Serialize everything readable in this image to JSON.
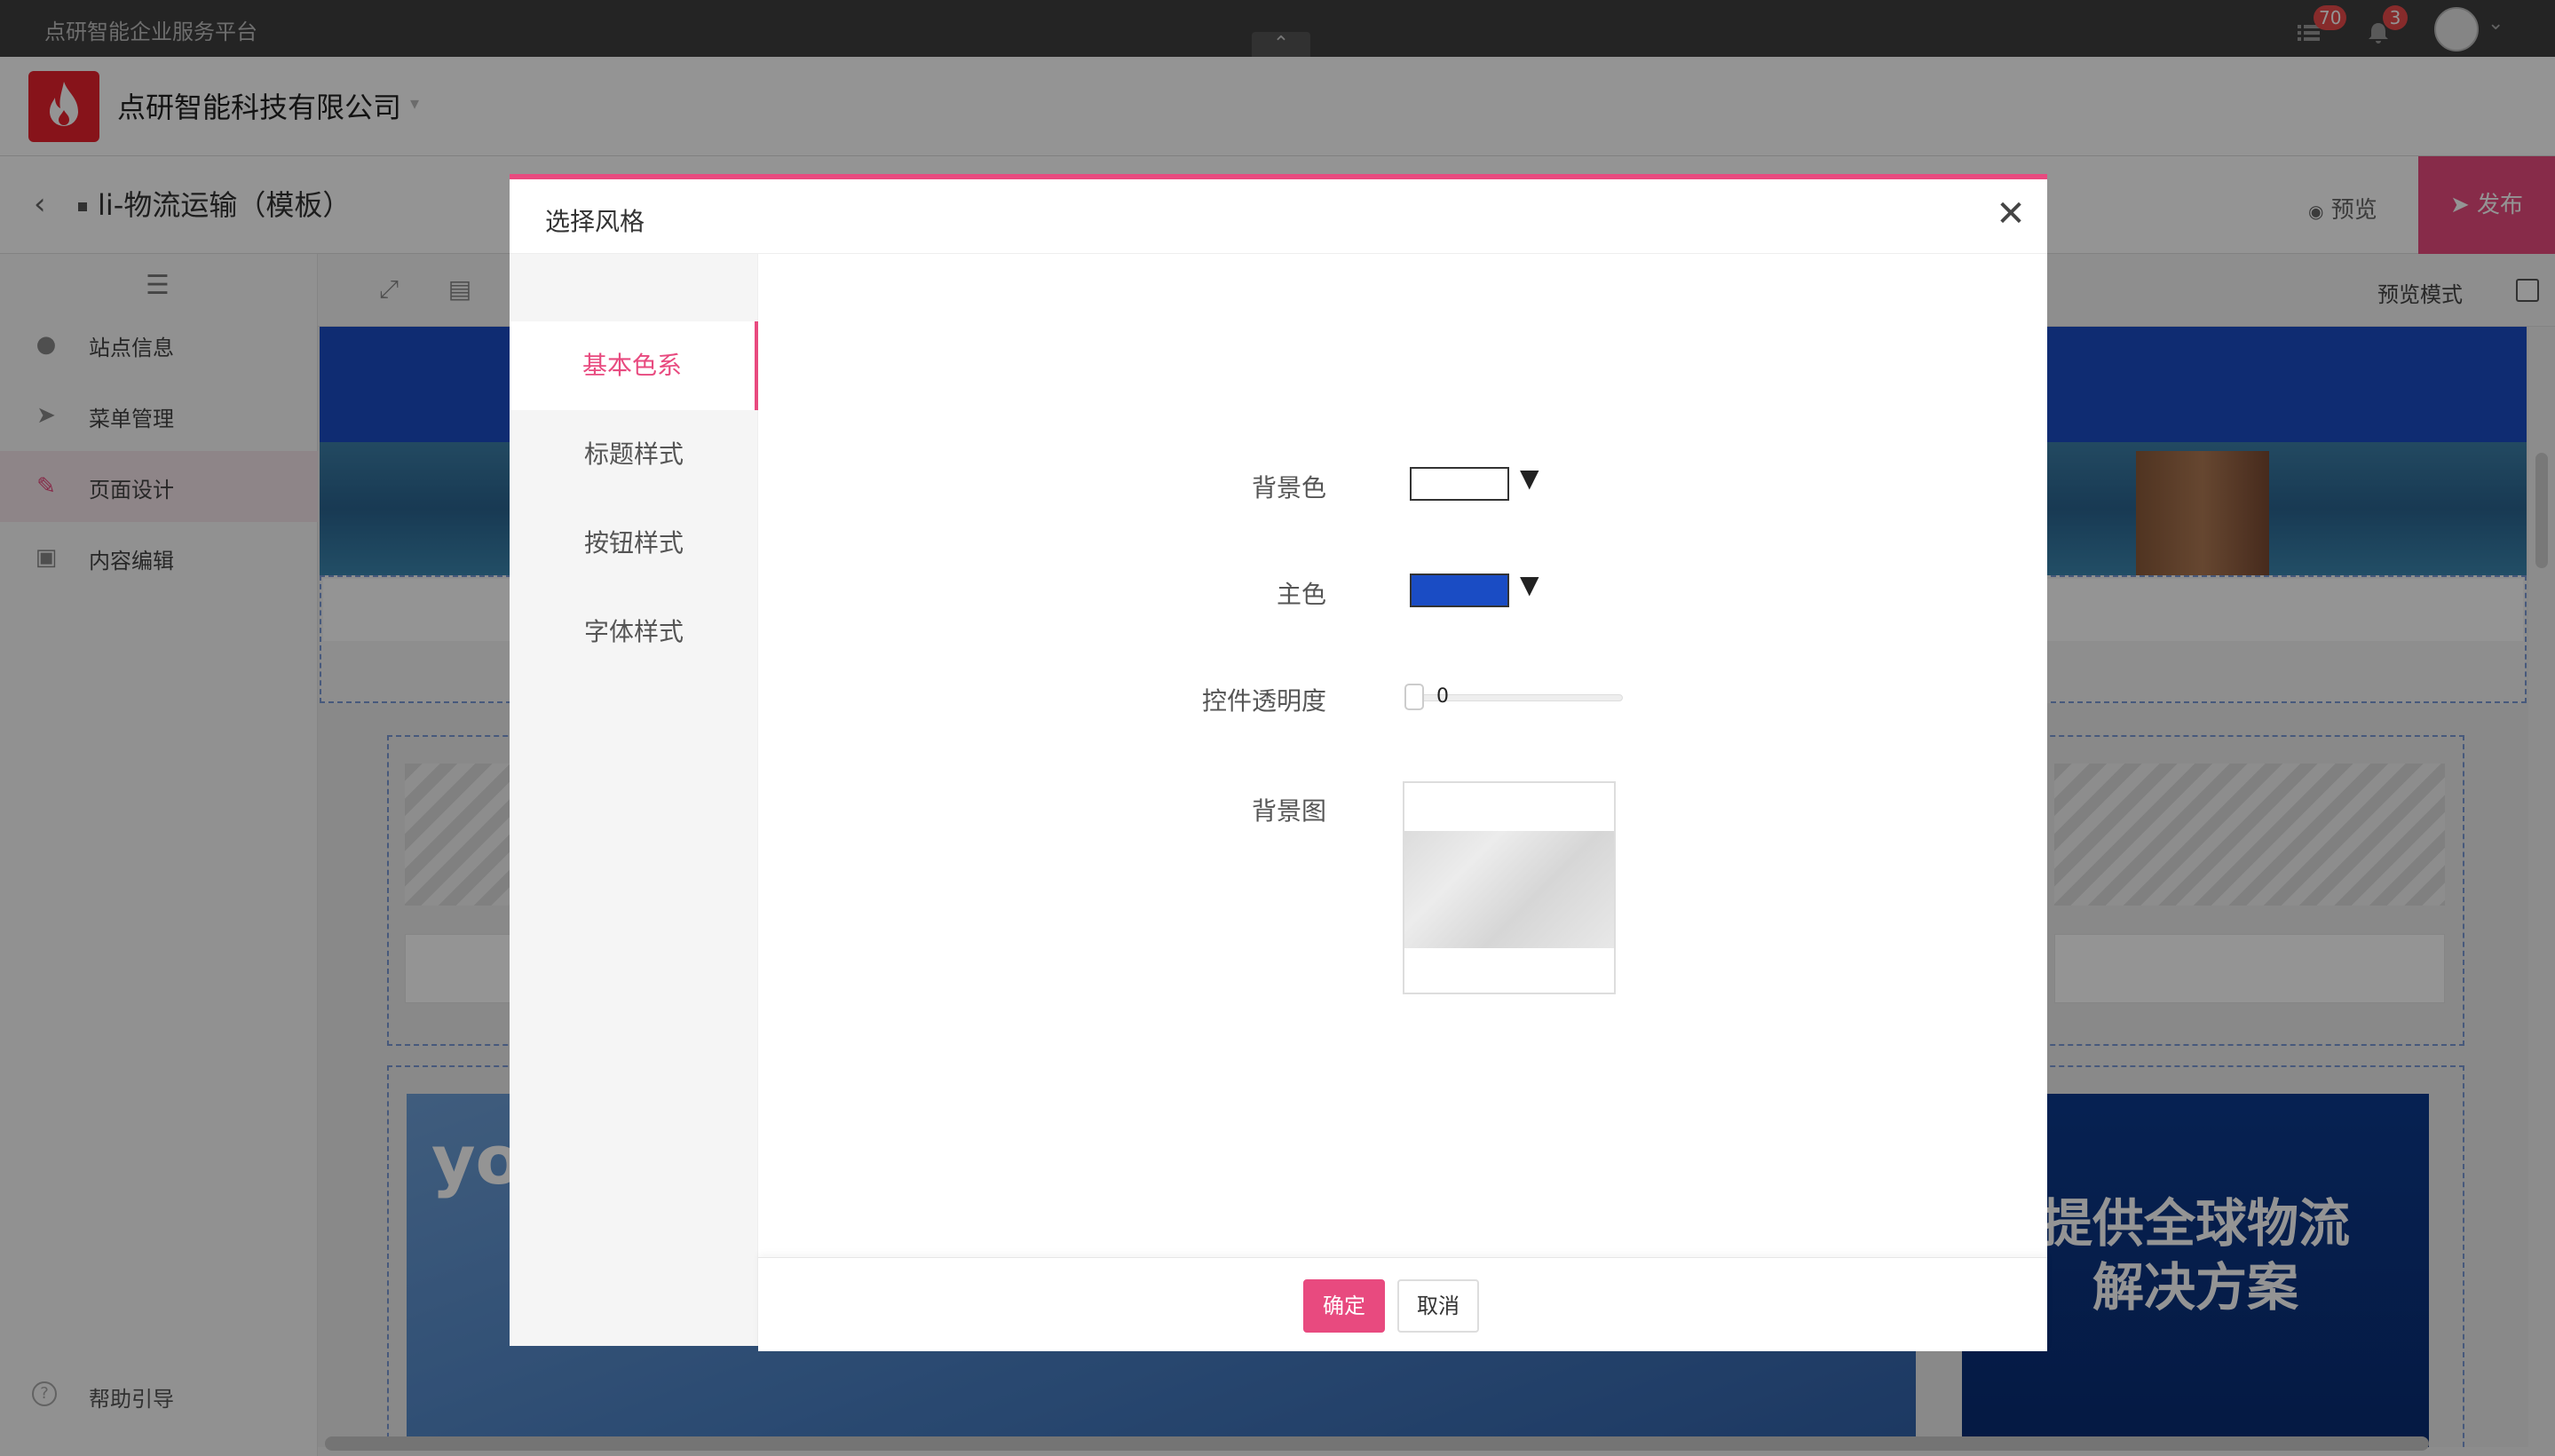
{
  "system_bar": {
    "platform_name": "点研智能企业服务平台",
    "messages_badge": "70",
    "notifications_badge": "3"
  },
  "header": {
    "company_name": "点研智能科技有限公司"
  },
  "titlebar": {
    "page_title": "li-物流运输（模板）",
    "preview_label": "预览",
    "publish_label": "发布"
  },
  "sidebar": {
    "items": [
      {
        "label": "站点信息",
        "icon": "globe-icon"
      },
      {
        "label": "菜单管理",
        "icon": "send-icon"
      },
      {
        "label": "页面设计",
        "icon": "brush-icon",
        "active": true
      },
      {
        "label": "内容编辑",
        "icon": "clipboard-icon"
      }
    ],
    "help_label": "帮助引导"
  },
  "toolbar": {
    "preview_mode_label": "预览模式"
  },
  "canvas": {
    "banner_text": "yo",
    "slogan_line1": "提供全球物流",
    "slogan_line2": "解决方案"
  },
  "dialog": {
    "title": "选择风格",
    "tabs": [
      "基本色系",
      "标题样式",
      "按钮样式",
      "字体样式"
    ],
    "active_tab": "基本色系",
    "fields": {
      "background_color_label": "背景色",
      "primary_color_label": "主色",
      "opacity_label": "控件透明度",
      "opacity_value": "0",
      "background_image_label": "背景图"
    },
    "colors": {
      "background_color": "#ffffff",
      "primary_color": "#1a4cc4",
      "accent": "#e84a7f"
    },
    "ok_label": "确定",
    "cancel_label": "取消"
  }
}
